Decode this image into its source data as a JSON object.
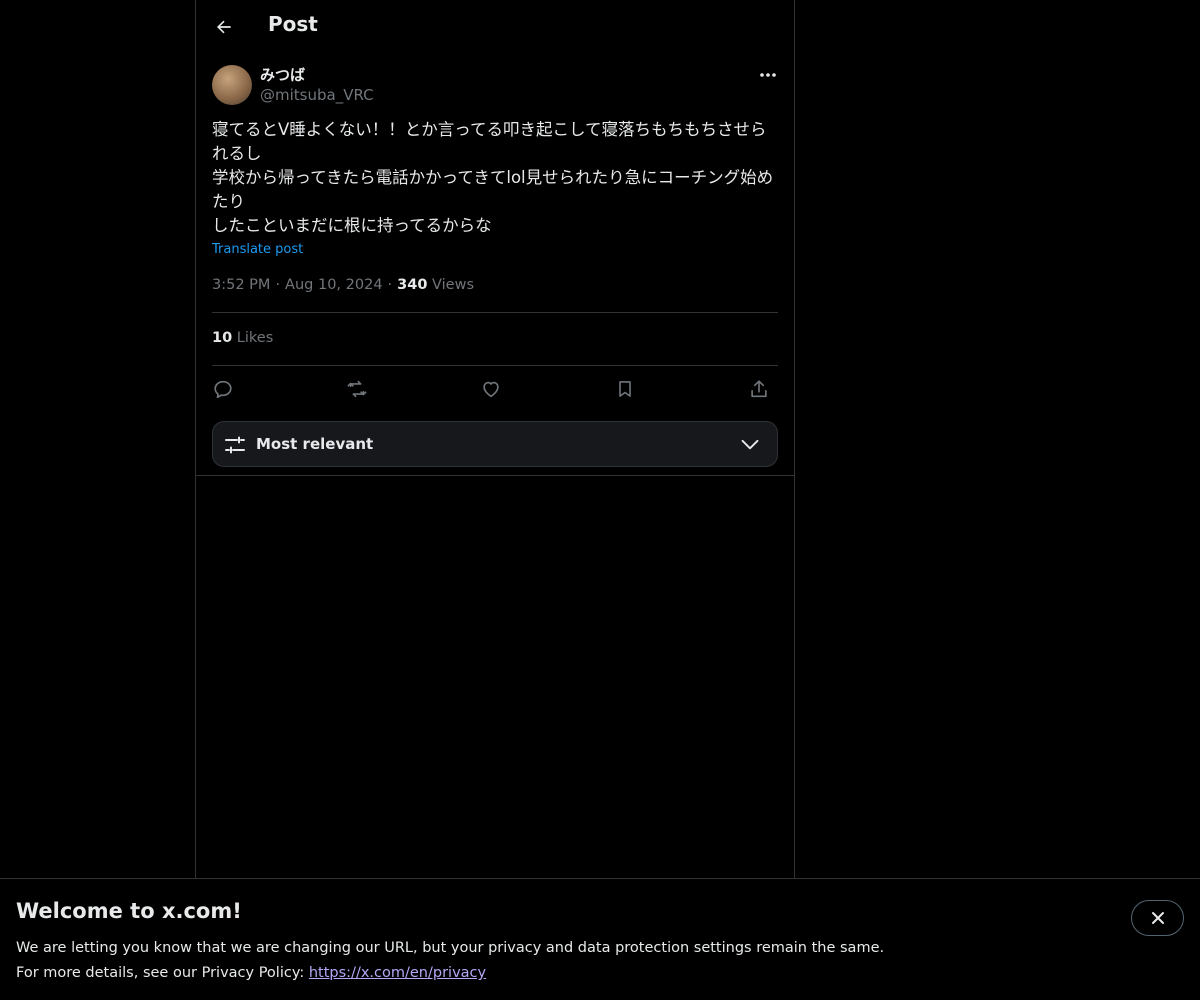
{
  "header": {
    "title": "Post"
  },
  "post": {
    "author": {
      "display_name": "みつば",
      "handle": "@mitsuba_VRC"
    },
    "lines": [
      "寝てるとV睡よくない！！とか言ってる叩き起こして寝落ちもちもちさせられるし",
      "学校から帰ってきたら電話かかってきてlol見せられたり急にコーチング始めたり",
      "したこといまだに根に持ってるからな"
    ],
    "translate_label": "Translate post",
    "time": "3:52 PM",
    "date": "Aug 10, 2024",
    "views_count": "340",
    "views_label": "Views",
    "likes_count": "10",
    "likes_label": "Likes"
  },
  "actions": {
    "icons": [
      "reply-icon",
      "repost-icon",
      "like-icon",
      "bookmark-icon",
      "share-icon"
    ]
  },
  "sort": {
    "label": "Most relevant"
  },
  "banner": {
    "title": "Welcome to x.com!",
    "line1": "We are letting you know that we are changing our URL, but your privacy and data protection settings remain the same.",
    "line2_prefix": "For more details, see our Privacy Policy: ",
    "link": "https://x.com/en/privacy"
  },
  "colors": {
    "background": "#000000",
    "text": "#e7e9ea",
    "muted": "#71767b",
    "accent": "#1d9bf0",
    "border": "#2f3336"
  }
}
